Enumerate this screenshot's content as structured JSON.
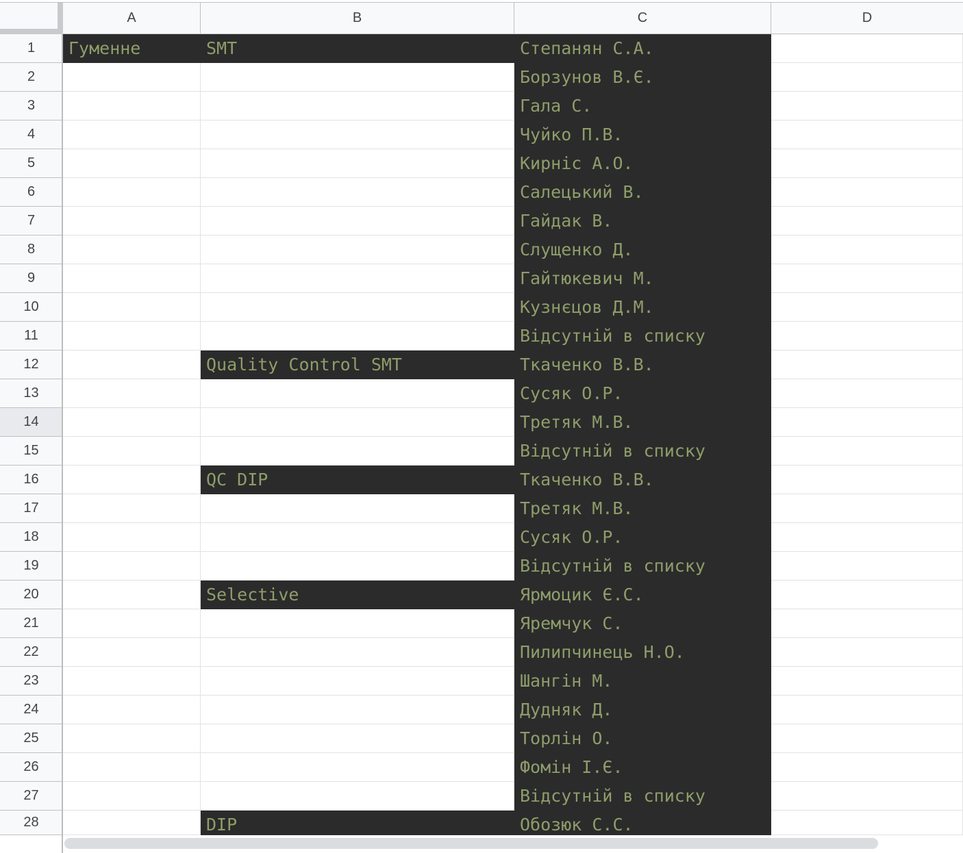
{
  "columns": [
    "A",
    "B",
    "C",
    "D"
  ],
  "selected_row": 14,
  "colors": {
    "dark_cell_bg": "#2b2b2b",
    "cell_text": "#8f9d6a",
    "header_bg": "#f8f9fa",
    "selected_header_bg": "#e8eaed"
  },
  "rows": [
    {
      "num": "1",
      "a": "Гуменне",
      "b": "SMT",
      "c": "Степанян С.А."
    },
    {
      "num": "2",
      "a": "",
      "b": "",
      "c": "Борзунов В.Є."
    },
    {
      "num": "3",
      "a": "",
      "b": "",
      "c": "Гала С."
    },
    {
      "num": "4",
      "a": "",
      "b": "",
      "c": "Чуйко П.В."
    },
    {
      "num": "5",
      "a": "",
      "b": "",
      "c": "Кирніс А.О."
    },
    {
      "num": "6",
      "a": "",
      "b": "",
      "c": "Салецький В."
    },
    {
      "num": "7",
      "a": "",
      "b": "",
      "c": "Гайдак В."
    },
    {
      "num": "8",
      "a": "",
      "b": "",
      "c": "Слущенко Д."
    },
    {
      "num": "9",
      "a": "",
      "b": "",
      "c": "Гайтюкевич М."
    },
    {
      "num": "10",
      "a": "",
      "b": "",
      "c": "Кузнєцов Д.М."
    },
    {
      "num": "11",
      "a": "",
      "b": "",
      "c": "Відсутній в списку"
    },
    {
      "num": "12",
      "a": "",
      "b": "Quality Control SMT",
      "c": "Ткаченко В.В."
    },
    {
      "num": "13",
      "a": "",
      "b": "",
      "c": "Сусяк О.Р."
    },
    {
      "num": "14",
      "a": "",
      "b": "",
      "c": "Третяк М.В."
    },
    {
      "num": "15",
      "a": "",
      "b": "",
      "c": "Відсутній в списку"
    },
    {
      "num": "16",
      "a": "",
      "b": "QC DIP",
      "c": "Ткаченко В.В."
    },
    {
      "num": "17",
      "a": "",
      "b": "",
      "c": "Третяк М.В."
    },
    {
      "num": "18",
      "a": "",
      "b": "",
      "c": "Сусяк О.Р."
    },
    {
      "num": "19",
      "a": "",
      "b": "",
      "c": "Відсутній в списку"
    },
    {
      "num": "20",
      "a": "",
      "b": "Selective",
      "c": "Ярмоцик Є.С."
    },
    {
      "num": "21",
      "a": "",
      "b": "",
      "c": "Яремчук С."
    },
    {
      "num": "22",
      "a": "",
      "b": "",
      "c": "Пилипчинець Н.О."
    },
    {
      "num": "23",
      "a": "",
      "b": "",
      "c": "Шангін М."
    },
    {
      "num": "24",
      "a": "",
      "b": "",
      "c": "Дудняк Д."
    },
    {
      "num": "25",
      "a": "",
      "b": "",
      "c": "Торлін О."
    },
    {
      "num": "26",
      "a": "",
      "b": "",
      "c": "Фомін І.Є."
    },
    {
      "num": "27",
      "a": "",
      "b": "",
      "c": "Відсутній в списку"
    },
    {
      "num": "28",
      "a": "",
      "b": "DIP",
      "c": "Обозюк С.С."
    }
  ]
}
